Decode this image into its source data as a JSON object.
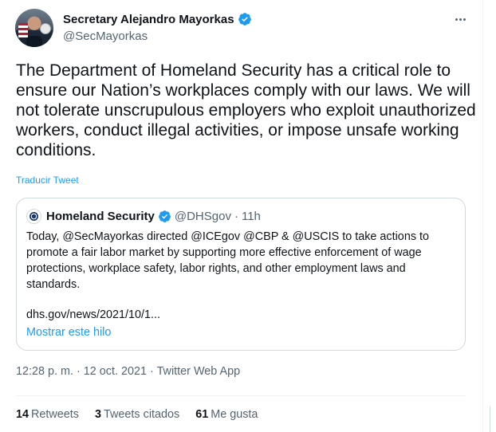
{
  "tweet": {
    "author_name": "Secretary Alejandro Mayorkas",
    "author_handle": "@SecMayorkas",
    "text": "The Department of Homeland Security has a critical role to ensure our Nation’s workplaces comply with our laws. We will not tolerate unscrupulous employers who exploit unauthorized workers, conduct illegal activities, or impose unsafe working conditions.",
    "translate_label": "Traducir Tweet",
    "more_icon": "more-horizontal-icon",
    "verified_icon": "verified-badge-icon",
    "colors": {
      "accent": "#1d9bf0",
      "muted": "#536471",
      "text": "#0f1419",
      "border": "#cfd9de"
    }
  },
  "quote": {
    "author_name": "Homeland Security",
    "author_handle": "@DHSgov",
    "separator": "·",
    "time": "11h",
    "text": "Today, @SecMayorkas directed @ICEgov @CBP & @USCIS to take actions to promote a fair labor market by supporting more effective enforcement of wage protections, workplace safety, labor rights, and other employment laws and standards.",
    "link": "dhs.gov/news/2021/10/1...",
    "show_thread_label": "Mostrar este hilo"
  },
  "meta": {
    "time": "12:28 p. m.",
    "separator1": "·",
    "date": "12 oct. 2021",
    "separator2": "·",
    "app": "Twitter Web App"
  },
  "stats": [
    {
      "count": "14",
      "label": "Retweets"
    },
    {
      "count": "3",
      "label": "Tweets citados"
    },
    {
      "count": "61",
      "label": "Me gusta"
    }
  ]
}
